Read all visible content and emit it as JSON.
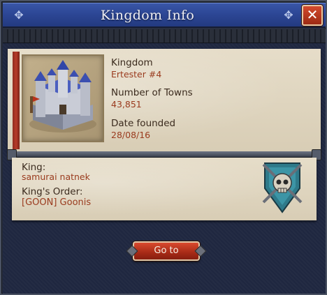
{
  "window": {
    "title": "Kingdom Info",
    "close_symbol": "✕"
  },
  "kingdom": {
    "label": "Kingdom",
    "value": "Ertester #4",
    "towns_label": "Number of Towns",
    "towns_value": "43,851",
    "founded_label": "Date founded",
    "founded_value": "28/08/16"
  },
  "king": {
    "label": "King:",
    "value": "samurai natnek",
    "order_label": "King's Order:",
    "order_value": "[GOON] Goonis"
  },
  "actions": {
    "goto_label": "Go to"
  },
  "icons": {
    "castle": "castle-icon",
    "emblem": "skull-shield-emblem-icon",
    "close": "close-icon",
    "ornament": "ornament-icon"
  },
  "colors": {
    "title_bar": "#2d4796",
    "parchment": "#e0d6c0",
    "value_text": "#9a3b1e",
    "button_red": "#b8321c"
  }
}
